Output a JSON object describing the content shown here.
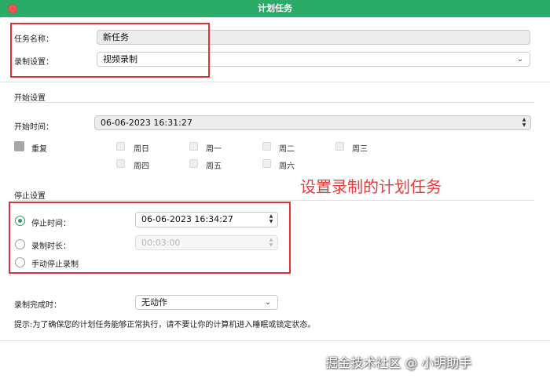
{
  "window": {
    "title": "计划任务"
  },
  "task": {
    "name_label": "任务名称：",
    "name_value": "新任务",
    "record_label": "录制设置：",
    "record_value": "视频录制"
  },
  "start": {
    "section_title": "开始设置",
    "time_label": "开始时间：",
    "time_value": "06-06-2023 16:31:27",
    "repeat_label": "重复",
    "days": [
      "周日",
      "周一",
      "周二",
      "周三",
      "周四",
      "周五",
      "周六"
    ]
  },
  "stop": {
    "section_title": "停止设置",
    "stop_time_label": "停止时间：",
    "stop_time_value": "06-06-2023 16:34:27",
    "duration_label": "录制时长：",
    "duration_value": "00:03:00",
    "manual_label": "手动停止录制"
  },
  "completion": {
    "label": "录制完成时：",
    "value": "无动作"
  },
  "tip": "提示:为了确保您的计划任务能够正常执行，请不要让你的计算机进入睡眠或锁定状态。",
  "annotation": "设置录制的计划任务",
  "watermark": "掘金技术社区 @ 小明助手"
}
